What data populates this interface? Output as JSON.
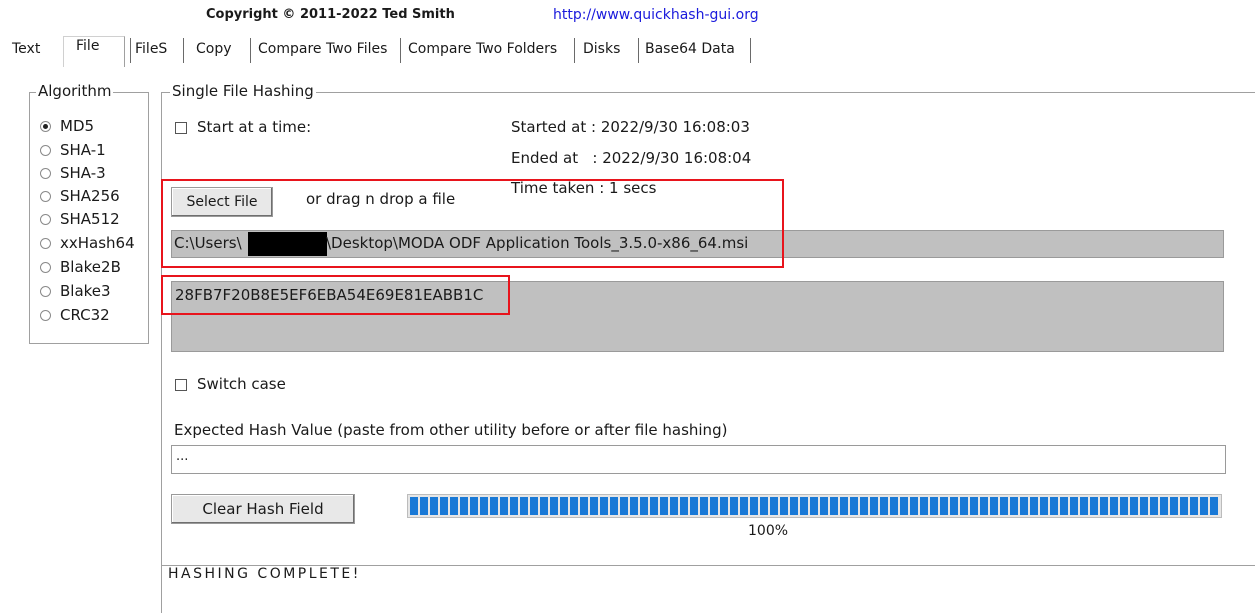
{
  "header": {
    "copyright": "Copyright © 2011-2022  Ted Smith",
    "url": "http://www.quickhash-gui.org"
  },
  "tabs": [
    {
      "label": "Text"
    },
    {
      "label": "File",
      "active": true
    },
    {
      "label": "FileS"
    },
    {
      "label": "Copy"
    },
    {
      "label": "Compare Two Files"
    },
    {
      "label": "Compare Two Folders"
    },
    {
      "label": "Disks"
    },
    {
      "label": "Base64 Data"
    }
  ],
  "algorithm": {
    "legend": "Algorithm",
    "selected": "MD5",
    "options": [
      "MD5",
      "SHA-1",
      "SHA-3",
      "SHA256",
      "SHA512",
      "xxHash64",
      "Blake2B",
      "Blake3",
      "CRC32"
    ]
  },
  "single_file": {
    "legend": "Single File Hashing",
    "start_at_time_label": "Start at a time:",
    "start_at_time_checked": false,
    "started_at": "Started at : 2022/9/30 16:08:03",
    "ended_at": "Ended at   : 2022/9/30 16:08:04",
    "time_taken": "Time taken : 1 secs",
    "select_file_label": "Select File",
    "drag_drop_label": "or drag n drop a file",
    "path_prefix": "C:\\Users\\",
    "path_suffix": "\\Desktop\\MODA ODF Application Tools_3.5.0-x86_64.msi",
    "hash_value": "28FB7F20B8E5EF6EBA54E69E81EABB1C",
    "switch_case_label": "Switch case",
    "switch_case_checked": false,
    "expected_hash_label": "Expected Hash Value (paste from other utility before or after file hashing)",
    "expected_hash_value": "...",
    "clear_hash_label": "Clear Hash Field",
    "progress_percent": 100,
    "progress_text": "100%"
  },
  "status": {
    "text": "HASHING COMPLETE!"
  },
  "colors": {
    "highlight_red": "#e8141c",
    "progress_blue": "#1979d6",
    "url_blue": "#1a1adc",
    "field_gray": "#c0c0c0"
  }
}
